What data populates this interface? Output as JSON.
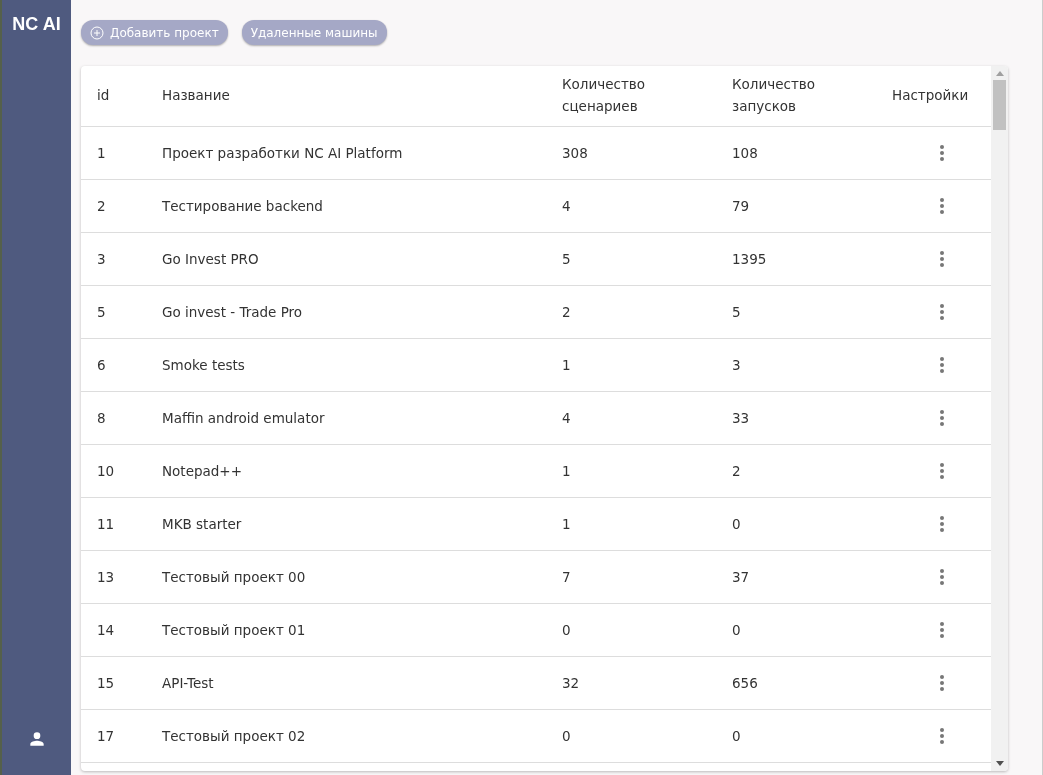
{
  "sidebar": {
    "logo": "NC AI"
  },
  "toolbar": {
    "buttons": [
      {
        "label": "Добавить проект",
        "kind": "add"
      },
      {
        "label": "Удаленные машины",
        "kind": "plain"
      }
    ]
  },
  "table": {
    "columns": [
      "id",
      "Название",
      "Количество сценариев",
      "Количество запусков",
      "Настройки"
    ],
    "rows": [
      {
        "id": "1",
        "name": "Проект разработки NC AI Platform",
        "scenarios": "308",
        "runs": "108"
      },
      {
        "id": "2",
        "name": "Тестирование backend",
        "scenarios": "4",
        "runs": "79"
      },
      {
        "id": "3",
        "name": "Go Invest PRO",
        "scenarios": "5",
        "runs": "1395"
      },
      {
        "id": "5",
        "name": "Go invest - Trade Pro",
        "scenarios": "2",
        "runs": "5"
      },
      {
        "id": "6",
        "name": "Smoke tests",
        "scenarios": "1",
        "runs": "3"
      },
      {
        "id": "8",
        "name": "Maffin android emulator",
        "scenarios": "4",
        "runs": "33"
      },
      {
        "id": "10",
        "name": "Notepad++",
        "scenarios": "1",
        "runs": "2"
      },
      {
        "id": "11",
        "name": "MKB starter",
        "scenarios": "1",
        "runs": "0"
      },
      {
        "id": "13",
        "name": "Тестовый проект 00",
        "scenarios": "7",
        "runs": "37"
      },
      {
        "id": "14",
        "name": "Тестовый проект 01",
        "scenarios": "0",
        "runs": "0"
      },
      {
        "id": "15",
        "name": "API-Test",
        "scenarios": "32",
        "runs": "656"
      },
      {
        "id": "17",
        "name": "Тестовый проект 02",
        "scenarios": "0",
        "runs": "0"
      }
    ]
  }
}
